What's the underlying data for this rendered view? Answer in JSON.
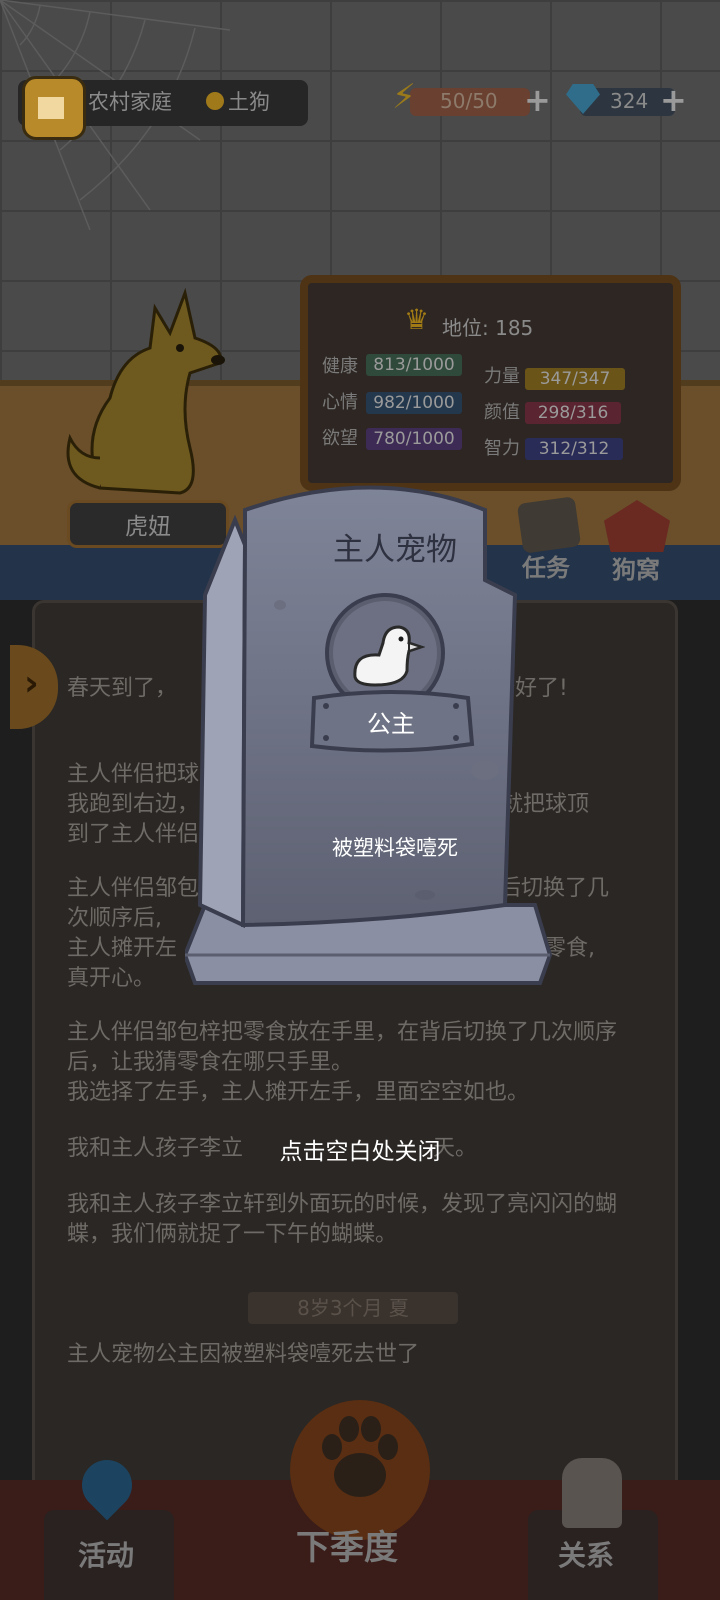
{
  "header": {
    "family": "农村家庭",
    "rank": "土狗",
    "energy": "50/50",
    "gems": "324",
    "plus": "+"
  },
  "dog": {
    "name": "虎妞"
  },
  "stats": {
    "status": "地位: 185",
    "items": [
      {
        "label": "健康",
        "value": "813/1000",
        "color": "#2f4a3a"
      },
      {
        "label": "心情",
        "value": "982/1000",
        "color": "#24384d"
      },
      {
        "label": "欲望",
        "value": "780/1000",
        "color": "#3d2a55"
      },
      {
        "label": "力量",
        "value": "347/347",
        "color": "#6a5418"
      },
      {
        "label": "颜值",
        "value": "298/316",
        "color": "#5a2430"
      },
      {
        "label": "智力",
        "value": "312/312",
        "color": "#2a2c58"
      }
    ]
  },
  "side_buttons": {
    "tasks": "任务",
    "kennel": "狗窝"
  },
  "story": {
    "p1": "春天到了，",
    "p1b": "已经准备好了!",
    "p2a": "主人伴侣把球",
    "p2b": "我跑到右边，",
    "p2c": "，就把球顶",
    "p2d": "到了主人伴侣",
    "p3a": "主人伴侣邹包",
    "p3b": "后切换了几",
    "p3c": "次顺序后,",
    "p3d": "主人摊开左",
    "p3e": "了零食,",
    "p3f": "真开心。",
    "p4": "主人伴侣邹包梓把零食放在手里，在背后切换了几次顺序后，让我猜零食在哪只手里。",
    "p5": "我选择了左手，主人摊开左手，里面空空如也。",
    "p6a": "我和主人孩子李立",
    "p6b": "天。",
    "p7": "我和主人孩子李立轩到外面玩的时候，发现了亮闪闪的蝴蝶，我们俩就捉了一下午的蝴蝶。",
    "age": "8岁3个月 夏",
    "p8": "主人宠物公主因被塑料袋噎死去世了"
  },
  "nav": {
    "activity": "活动",
    "next_season": "下季度",
    "relations": "关系"
  },
  "modal": {
    "title": "主人宠物",
    "pet_name": "公主",
    "cause": "被塑料袋噎死",
    "close_hint": "点击空白处关闭"
  },
  "icons": [
    "home-icon",
    "rank-medal-icon",
    "lightning-icon",
    "gem-icon",
    "crown-icon",
    "paw-icon",
    "map-pin-icon",
    "handshake-icon",
    "duck-icon",
    "chevron-right-icon"
  ]
}
